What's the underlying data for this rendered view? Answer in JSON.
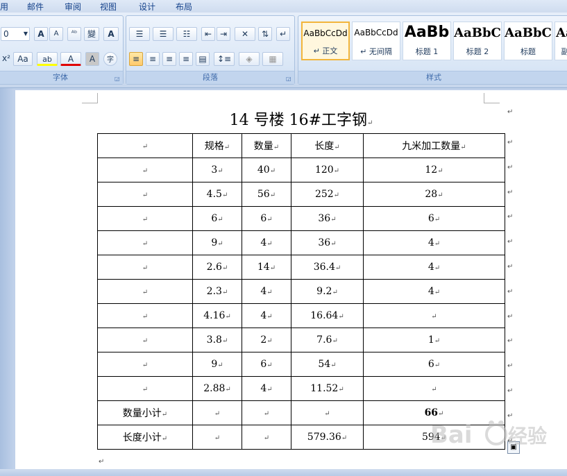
{
  "tabs": [
    "用",
    "邮件",
    "审阅",
    "视图",
    "设计",
    "布局"
  ],
  "ribbon": {
    "font_group": {
      "label": "字体",
      "font_size": "0",
      "grow_label": "A",
      "shrink_label": "A",
      "phonetic_label": "變",
      "char_border_label": "A",
      "superscript_label": "x²",
      "case_label": "Aa",
      "highlight_label": "ab",
      "font_color_label": "A",
      "shading_label": "A",
      "enclose_label": "字"
    },
    "paragraph_group": {
      "label": "段落"
    },
    "styles_group": {
      "label": "样式",
      "cards": [
        {
          "sample": "AaBbCcDd",
          "name": "↵ 正文"
        },
        {
          "sample": "AaBbCcDd",
          "name": "↵ 无间隔"
        },
        {
          "sample": "AaBb",
          "name": "标题 1"
        },
        {
          "sample": "AaBbC",
          "name": "标题 2"
        },
        {
          "sample": "AaBbC",
          "name": "标题"
        },
        {
          "sample": "Aa",
          "name": "副"
        }
      ]
    }
  },
  "document": {
    "title": "14 号楼 16#工字钢",
    "headers": [
      "",
      "规格",
      "数量",
      "长度",
      "九米加工数量"
    ],
    "rows": [
      [
        "",
        "3",
        "40",
        "120",
        "12"
      ],
      [
        "",
        "4.5",
        "56",
        "252",
        "28"
      ],
      [
        "",
        "6",
        "6",
        "36",
        "6"
      ],
      [
        "",
        "9",
        "4",
        "36",
        "4"
      ],
      [
        "",
        "2.6",
        "14",
        "36.4",
        "4"
      ],
      [
        "",
        "2.3",
        "4",
        "9.2",
        "4"
      ],
      [
        "",
        "4.16",
        "4",
        "16.64",
        ""
      ],
      [
        "",
        "3.8",
        "2",
        "7.6",
        "1"
      ],
      [
        "",
        "9",
        "6",
        "54",
        "6"
      ],
      [
        "",
        "2.88",
        "4",
        "11.52",
        ""
      ],
      [
        "数量小计",
        "",
        "",
        "",
        "66"
      ],
      [
        "长度小计",
        "",
        "",
        "579.36",
        "594"
      ]
    ],
    "paragraph_mark": "↵"
  },
  "colors": {
    "ribbon_text": "#15428b",
    "active_button": "#ffc96b",
    "page": "#ffffff"
  }
}
